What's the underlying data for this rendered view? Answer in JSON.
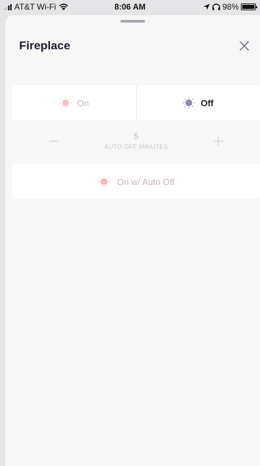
{
  "status_bar": {
    "carrier": "AT&T Wi-Fi",
    "time": "8:06 AM",
    "battery": "98%",
    "battery_level": 0.98
  },
  "sheet": {
    "title": "Fireplace"
  },
  "controls": {
    "on_label": "On",
    "off_label": "Off",
    "selected": "off",
    "auto_off_value": "5",
    "auto_off_label": "AUTO OFF MINUTES",
    "on_auto_off_label": "On w/ Auto Off"
  },
  "colors": {
    "on_dot": "#f4c2c8",
    "off_dot": "#8b8fa8",
    "auto_dot": "#f6b7b9"
  },
  "icons": {
    "close": "close-icon",
    "minus": "minus-icon",
    "plus": "plus-icon",
    "sun": "sun-icon"
  }
}
